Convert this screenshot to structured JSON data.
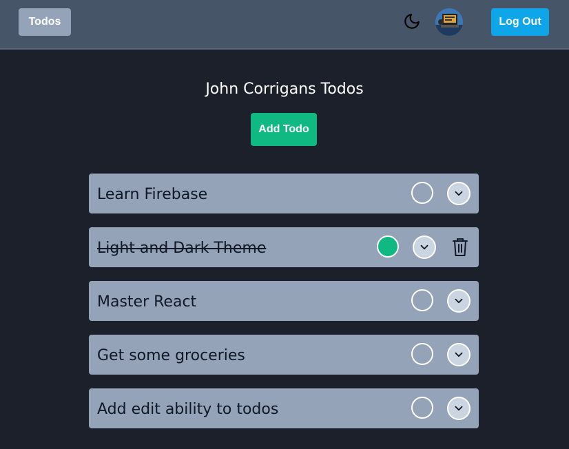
{
  "navbar": {
    "brand_label": "Todos",
    "logout_label": "Log Out",
    "theme_icon": "moon-icon"
  },
  "main": {
    "title": "John Corrigans Todos",
    "add_label": "Add Todo"
  },
  "todos": [
    {
      "label": "Learn Firebase",
      "completed": false
    },
    {
      "label": "Light and Dark Theme",
      "completed": true
    },
    {
      "label": "Master React",
      "completed": false
    },
    {
      "label": "Get some groceries",
      "completed": false
    },
    {
      "label": "Add edit ability to todos",
      "completed": false
    }
  ],
  "colors": {
    "background": "#1b202b",
    "navbar": "#475569",
    "card": "#94a3b8",
    "accent_green": "#10b981",
    "accent_blue": "#0ea5e9"
  }
}
